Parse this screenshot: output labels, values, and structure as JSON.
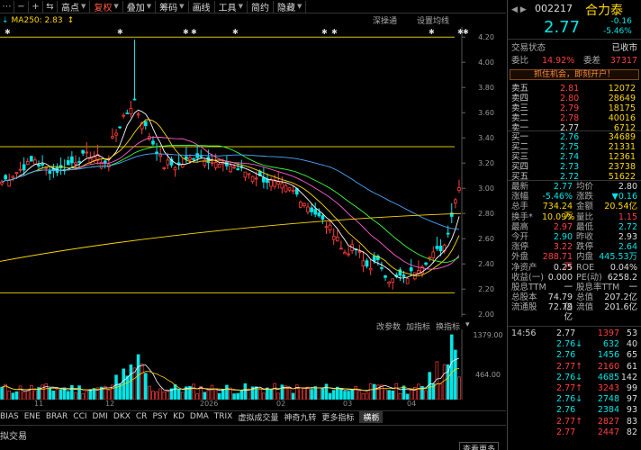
{
  "toolbar": {
    "buttons": [
      "高点",
      "复权",
      "叠加",
      "筹码",
      "画线",
      "工具",
      "简约",
      "隐藏"
    ],
    "active": "复权"
  },
  "legend": {
    "ma_label": "MA250: 2.83",
    "right_items": [
      "深操通",
      "设置均线"
    ]
  },
  "kchart": {
    "y_ticks": [
      "4.20",
      "4.00",
      "3.80",
      "3.60",
      "3.40",
      "3.20",
      "3.00",
      "2.80",
      "2.60",
      "2.40",
      "2.20",
      "2.00"
    ],
    "date_labels": [
      "11",
      "12",
      "2026",
      "02",
      "03",
      "04"
    ]
  },
  "volume": {
    "header": [
      "改参数",
      "加指标",
      "换指标"
    ],
    "y_ticks": [
      "1379.00",
      "464.00"
    ]
  },
  "indicators": [
    "BIAS",
    "ENE",
    "BRAR",
    "CCI",
    "DMI",
    "DKX",
    "CR",
    "PSY",
    "KD",
    "DMA",
    "TRIX",
    "虚拟成交量",
    "神奇九转",
    "更多指标",
    "横栃"
  ],
  "status": {
    "text": "拟交易",
    "button": "查看更多"
  },
  "quote": {
    "code": "002217",
    "name": "合力泰",
    "price": "2.77",
    "change": "-0.16",
    "change_pct": "-5.46%",
    "state_label": "交易状态",
    "state_value": "已收市",
    "weibi_label": "委比",
    "weibi_value": "14.92%",
    "weicha_label": "委差",
    "weicha_value": "37317",
    "banner": "抓住机会，即刻开户！"
  },
  "orderbook": {
    "asks": [
      {
        "label": "卖五",
        "price": "2.81",
        "vol": "12072"
      },
      {
        "label": "卖四",
        "price": "2.80",
        "vol": "28649"
      },
      {
        "label": "卖三",
        "price": "2.79",
        "vol": "18175"
      },
      {
        "label": "卖二",
        "price": "2.78",
        "vol": "40016"
      },
      {
        "label": "卖一",
        "price": "2.77",
        "vol": "6712"
      }
    ],
    "bids": [
      {
        "label": "买一",
        "price": "2.76",
        "vol": "34689"
      },
      {
        "label": "买二",
        "price": "2.75",
        "vol": "21331"
      },
      {
        "label": "买三",
        "price": "2.74",
        "vol": "12361"
      },
      {
        "label": "买四",
        "price": "2.73",
        "vol": "23738"
      },
      {
        "label": "买五",
        "price": "2.72",
        "vol": "51622"
      }
    ]
  },
  "stats": [
    {
      "l1": "最新",
      "v1": "2.77",
      "c1": "cyan",
      "l2": "均价",
      "v2": "2.80",
      "c2": "wht"
    },
    {
      "l1": "涨幅",
      "v1": "-5.46%",
      "c1": "cyan",
      "l2": "涨跌",
      "v2": "▼0.16",
      "c2": "cyan"
    },
    {
      "l1": "总手",
      "v1": "734.24万",
      "c1": "yel",
      "l2": "金额",
      "v2": "20.54亿",
      "c2": "yel"
    },
    {
      "l1": "换手*",
      "v1": "10.09%",
      "c1": "yel",
      "l2": "量比",
      "v2": "1.15",
      "c2": "red"
    },
    {
      "l1": "最高",
      "v1": "2.97",
      "c1": "red",
      "l2": "最低",
      "v2": "2.72",
      "c2": "cyan"
    },
    {
      "l1": "今开",
      "v1": "2.90",
      "c1": "cyan",
      "l2": "昨收",
      "v2": "2.93",
      "c2": "wht"
    },
    {
      "l1": "涨停",
      "v1": "3.22",
      "c1": "red",
      "l2": "跌停",
      "v2": "2.64",
      "c2": "cyan"
    },
    {
      "l1": "外盘",
      "v1": "288.71万",
      "c1": "red",
      "l2": "内盘",
      "v2": "445.53万",
      "c2": "cyan"
    },
    {
      "l1": "净资产",
      "v1": "0.25",
      "c1": "wht",
      "l2": "ROE",
      "v2": "0.04%",
      "c2": "wht"
    },
    {
      "l1": "收益(一)",
      "v1": "0.000",
      "c1": "wht",
      "l2": "PE(动)",
      "v2": "6258.2",
      "c2": "wht"
    },
    {
      "l1": "股息TTM",
      "v1": "一",
      "c1": "wht",
      "l2": "股息率TTM",
      "v2": "一",
      "c2": "wht"
    },
    {
      "l1": "总股本",
      "v1": "74.79亿",
      "c1": "wht",
      "l2": "总值",
      "v2": "207.2亿",
      "c2": "wht"
    },
    {
      "l1": "流通股",
      "v1": "72.79亿",
      "c1": "wht",
      "l2": "流值",
      "v2": "201.6亿",
      "c2": "wht"
    }
  ],
  "ticks": [
    {
      "time": "14:56",
      "price": "2.77",
      "arrow": "",
      "vol": "1397",
      "vc": "red",
      "n": "53"
    },
    {
      "time": "",
      "price": "2.76",
      "arrow": "↓",
      "vol": "632",
      "vc": "cyan",
      "n": "40"
    },
    {
      "time": "",
      "price": "2.76",
      "arrow": "",
      "vol": "1456",
      "vc": "cyan",
      "n": "65"
    },
    {
      "time": "",
      "price": "2.77",
      "arrow": "↑",
      "vol": "2160",
      "vc": "red",
      "n": "61"
    },
    {
      "time": "",
      "price": "2.76",
      "arrow": "↓",
      "vol": "4685",
      "vc": "cyan",
      "n": "142"
    },
    {
      "time": "",
      "price": "2.77",
      "arrow": "↑",
      "vol": "3243",
      "vc": "red",
      "n": "99"
    },
    {
      "time": "",
      "price": "2.76",
      "arrow": "↓",
      "vol": "2748",
      "vc": "cyan",
      "n": "97"
    },
    {
      "time": "",
      "price": "2.76",
      "arrow": "",
      "vol": "2384",
      "vc": "cyan",
      "n": "93"
    },
    {
      "time": "",
      "price": "2.77",
      "arrow": "↑",
      "vol": "2827",
      "vc": "red",
      "n": "83"
    },
    {
      "time": "",
      "price": "2.77",
      "arrow": "",
      "vol": "2447",
      "vc": "red",
      "n": "82"
    }
  ]
}
